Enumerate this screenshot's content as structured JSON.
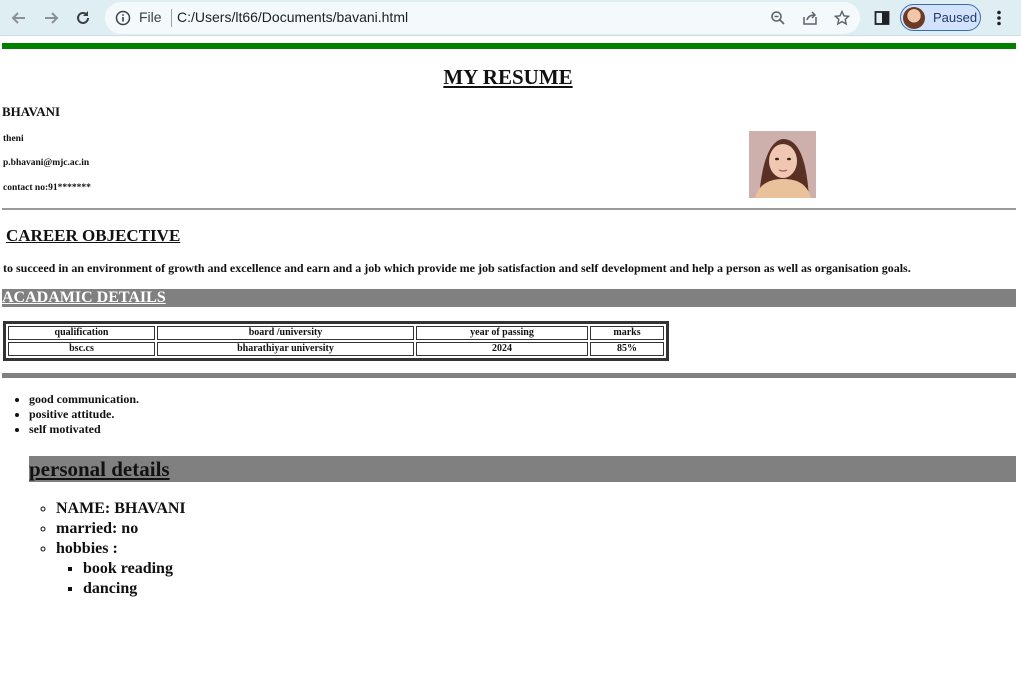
{
  "browser": {
    "scheme_label": "File",
    "url": "C:/Users/lt66/Documents/bavani.html",
    "profile_label": "Paused"
  },
  "resume": {
    "title": "MY RESUME",
    "name": "BHAVANI",
    "location": "theni",
    "email": "p.bhavani@mjc.ac.in",
    "contact": "contact no:91*******",
    "career_heading": "CAREER OBJECTIVE",
    "career_text": "to succeed in an environment of growth and excellence and earn and a job which provide me job satisfaction and self development and help a person as well as organisation goals.",
    "academic_heading": "ACADAMIC DETAILS",
    "academic_table": {
      "headers": [
        "qualification",
        "board /university",
        "year of passing",
        "marks"
      ],
      "rows": [
        [
          "bsc.cs",
          "bharathiyar university",
          "2024",
          "85%"
        ]
      ]
    },
    "skills": [
      "good communication.",
      "positive attitude.",
      "self motivated"
    ],
    "personal_heading": "personal details",
    "personal": {
      "name": "NAME: BHAVANI",
      "married": "married: no",
      "hobbies_label": "hobbies :",
      "hobbies": [
        "book reading",
        "dancing"
      ]
    }
  }
}
